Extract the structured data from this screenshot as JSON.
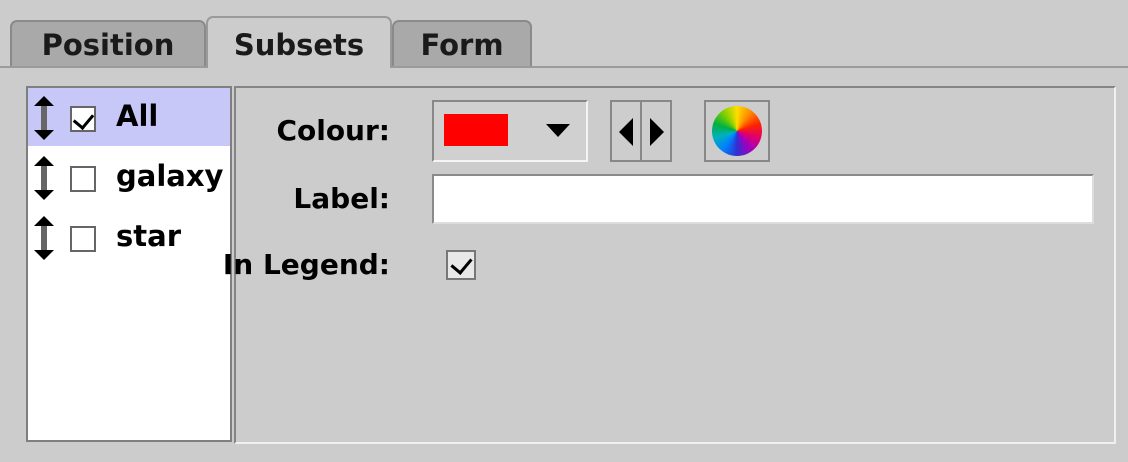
{
  "tabs": [
    {
      "label": "Position",
      "active": false
    },
    {
      "label": "Subsets",
      "active": true
    },
    {
      "label": "Form",
      "active": false
    }
  ],
  "subsets": [
    {
      "label": "All",
      "checked": true,
      "selected": true
    },
    {
      "label": "galaxy",
      "checked": false,
      "selected": false
    },
    {
      "label": "star",
      "checked": false,
      "selected": false
    }
  ],
  "form": {
    "colour_label": "Colour:",
    "colour_value": "#ff0000",
    "label_label": "Label:",
    "label_value": "",
    "in_legend_label": "In Legend:",
    "in_legend_checked": true
  },
  "icons": {
    "drag": "drag-handle-icon",
    "dropdown": "chevron-down-icon",
    "prev": "arrow-left-icon",
    "next": "arrow-right-icon",
    "color_wheel": "color-wheel-icon"
  }
}
